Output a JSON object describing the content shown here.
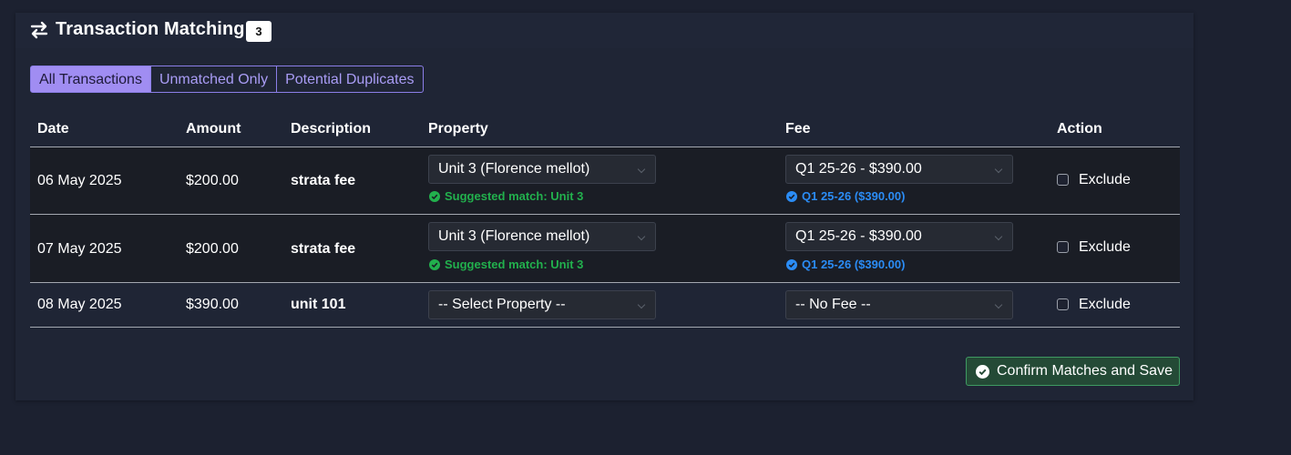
{
  "header": {
    "title": "Transaction Matching",
    "count": "3",
    "icon": "swap-arrows-icon"
  },
  "tabs": [
    {
      "label": "All Transactions",
      "active": true
    },
    {
      "label": "Unmatched Only",
      "active": false
    },
    {
      "label": "Potential Duplicates",
      "active": false
    }
  ],
  "columns": [
    "Date",
    "Amount",
    "Description",
    "Property",
    "Fee",
    "Action"
  ],
  "rows": [
    {
      "date": "06 May 2025",
      "amount": "$200.00",
      "description": "strata fee",
      "property": "Unit 3 (Florence mellot)",
      "property_hint": "Suggested match: Unit 3",
      "fee": "Q1 25-26 - $390.00",
      "fee_hint": "Q1 25-26 ($390.00)",
      "exclude_label": "Exclude",
      "excluded": false
    },
    {
      "date": "07 May 2025",
      "amount": "$200.00",
      "description": "strata fee",
      "property": "Unit 3 (Florence mellot)",
      "property_hint": "Suggested match: Unit 3",
      "fee": "Q1 25-26 - $390.00",
      "fee_hint": "Q1 25-26 ($390.00)",
      "exclude_label": "Exclude",
      "excluded": false
    },
    {
      "date": "08 May 2025",
      "amount": "$390.00",
      "description": "unit 101",
      "property": "-- Select Property --",
      "fee": "-- No Fee --",
      "exclude_label": "Exclude",
      "excluded": false
    }
  ],
  "confirm_button": {
    "label": "Confirm Matches and Save",
    "icon": "check-circle-icon"
  },
  "colors": {
    "page_bg": "#1c2130",
    "card_bg": "#1f2535",
    "row_bg": "#1a1d25",
    "tab_active": "#a08df2",
    "tab_border": "#8b7ee8",
    "hint_green": "#22b04d",
    "hint_blue": "#2b8cf5",
    "confirm_bg": "#244a36"
  }
}
